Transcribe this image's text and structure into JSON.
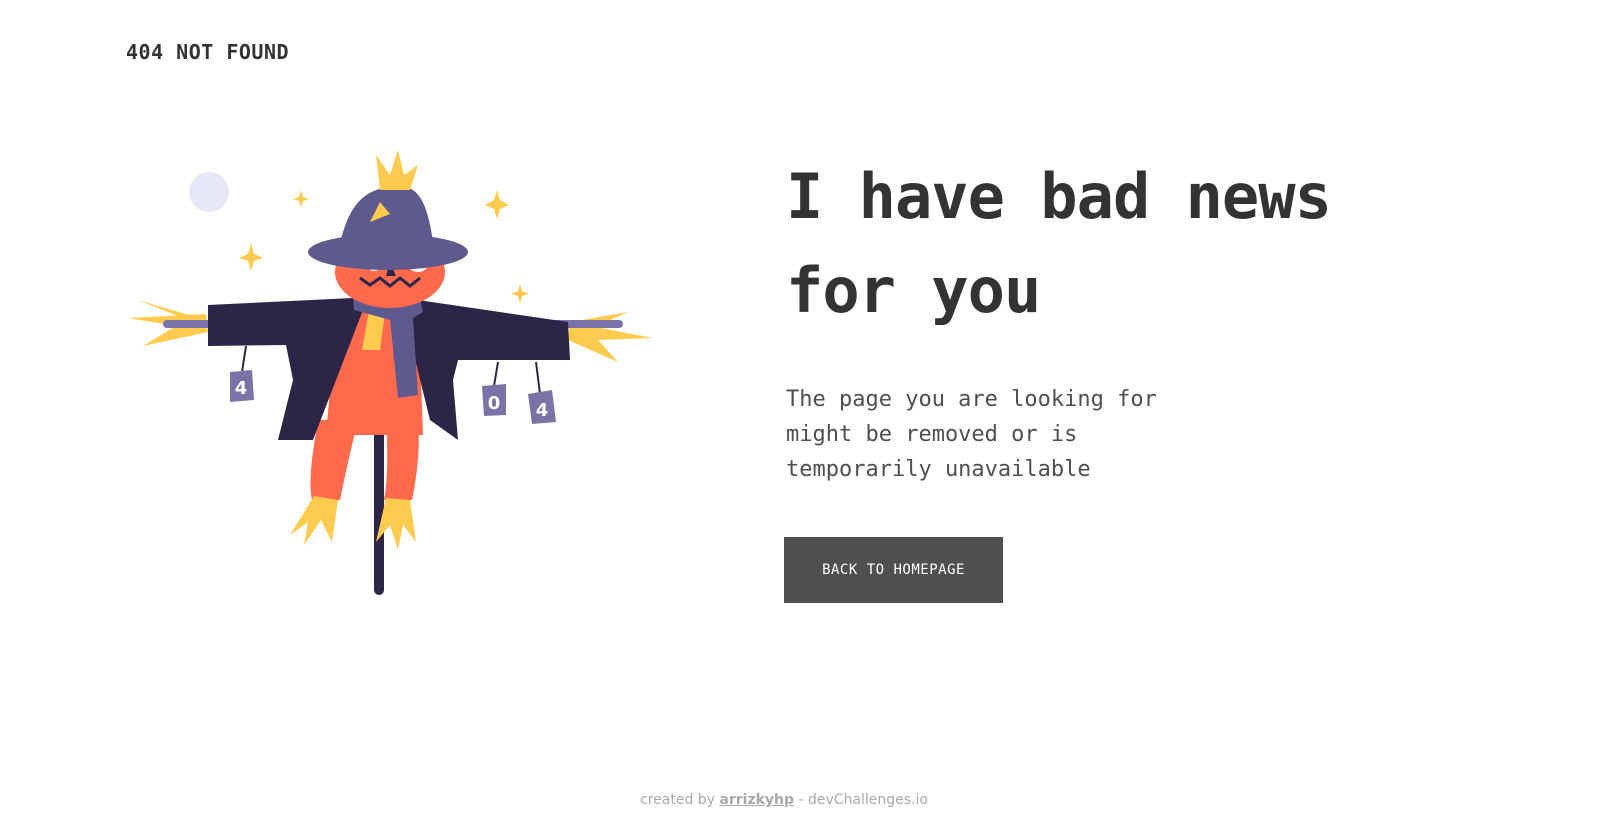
{
  "header": {
    "brand": "404 NOT FOUND"
  },
  "main": {
    "headline": "I have bad news for you",
    "message": "The page you are looking for might be removed or is temporarily unavailable",
    "cta_label": "BACK TO HOMEPAGE"
  },
  "illustration": {
    "cans": [
      "4",
      "0",
      "4"
    ]
  },
  "footer": {
    "prefix": "created by",
    "author": "arrizkyhp",
    "suffix": "- devChallenges.io"
  },
  "colors": {
    "button_bg": "#4f4f4f",
    "text": "#333333",
    "hat": "#5f5a8d",
    "coat": "#2c2547",
    "pumpkin": "#ff6a4d",
    "straw": "#ffcb4f"
  }
}
